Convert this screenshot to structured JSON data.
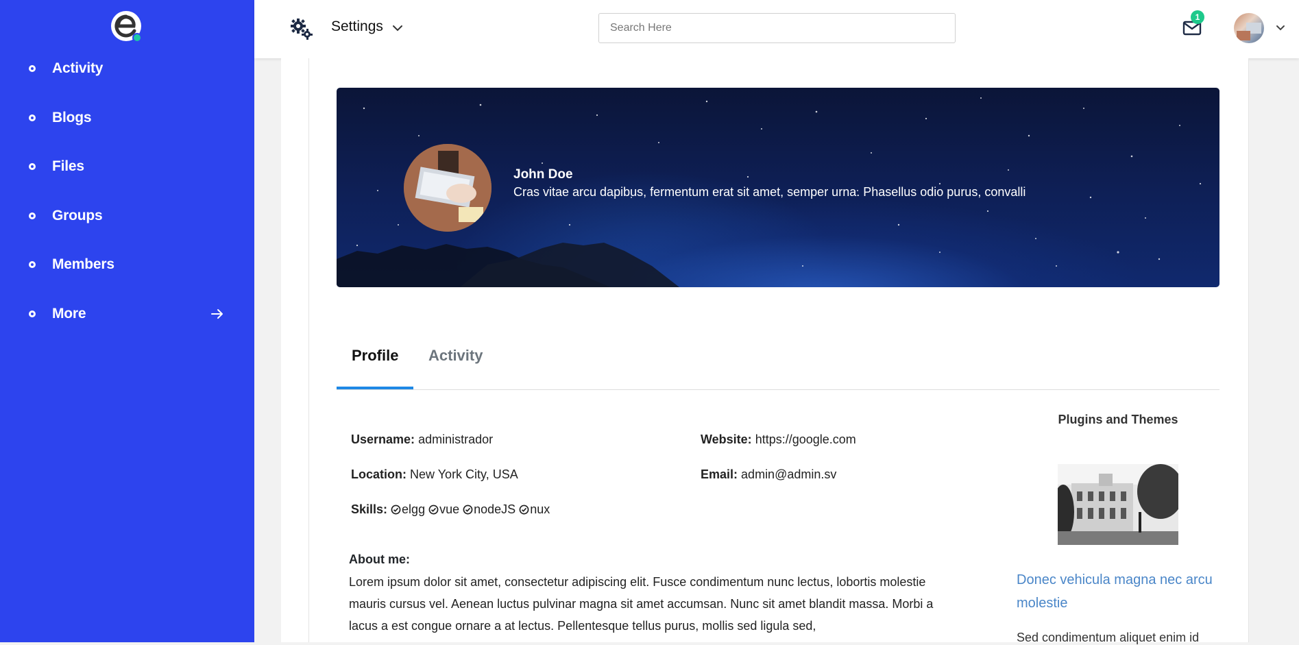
{
  "sidebar": {
    "logo_icon": "elgg-logo",
    "items": [
      {
        "label": "Activity"
      },
      {
        "label": "Blogs"
      },
      {
        "label": "Files"
      },
      {
        "label": "Groups"
      },
      {
        "label": "Members"
      },
      {
        "label": "More",
        "icon": "arrow-right-icon"
      }
    ],
    "background": "#2d44ee"
  },
  "header": {
    "settings_label": "Settings",
    "search_placeholder": "Search Here",
    "mail_badge": "1",
    "badge_color": "#1ec98b"
  },
  "banner": {
    "name": "John Doe",
    "description": "Cras vitae arcu dapibus, fermentum erat sit amet, semper urna. Phasellus odio purus, convalli"
  },
  "tabs": [
    {
      "label": "Profile",
      "active": true
    },
    {
      "label": "Activity",
      "active": false
    }
  ],
  "profile": {
    "username_label": "Username:",
    "username": "administrador",
    "website_label": "Website:",
    "website": "https://google.com",
    "location_label": "Location:",
    "location": "New York City, USA",
    "email_label": "Email:",
    "email": "admin@admin.sv",
    "skills_label": "Skills:",
    "skills": [
      "elgg",
      "vue",
      "nodeJS",
      "nux"
    ],
    "about_label": "About me:",
    "about_text": "Lorem ipsum dolor sit amet, consectetur adipiscing elit. Fusce condimentum nunc lectus, lobortis molestie mauris cursus vel. Aenean luctus pulvinar magna sit amet accumsan. Nunc sit amet blandit massa. Morbi a lacus a est congue ornare a at lectus. Pellentesque tellus purus, mollis sed ligula sed,"
  },
  "plugins": {
    "title": "Plugins and Themes",
    "link": "Donec vehicula magna nec arcu molestie",
    "text": "Sed condimentum aliquet enim id"
  }
}
